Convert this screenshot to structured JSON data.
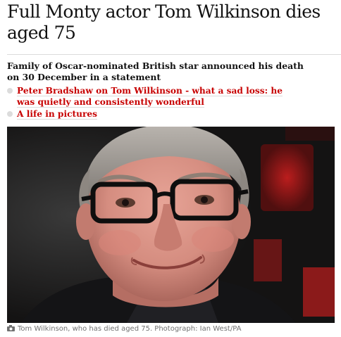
{
  "article": {
    "headline": "Full Monty actor Tom Wilkinson dies aged 75",
    "standfirst": "Family of Oscar-nominated British star announced his death on 30 December in a statement",
    "related_links": [
      {
        "label": "Peter Bradshaw on Tom Wilkinson - what a sad loss: he was quietly and consistently wonderful"
      },
      {
        "label": "A life in pictures"
      }
    ],
    "image": {
      "caption": "Tom Wilkinson, who has died aged 75. Photograph: Ian West/PA",
      "icon": "camera-icon"
    }
  },
  "colors": {
    "link": "#c70000",
    "caption": "#707070",
    "bullet": "#dcdcdc"
  }
}
